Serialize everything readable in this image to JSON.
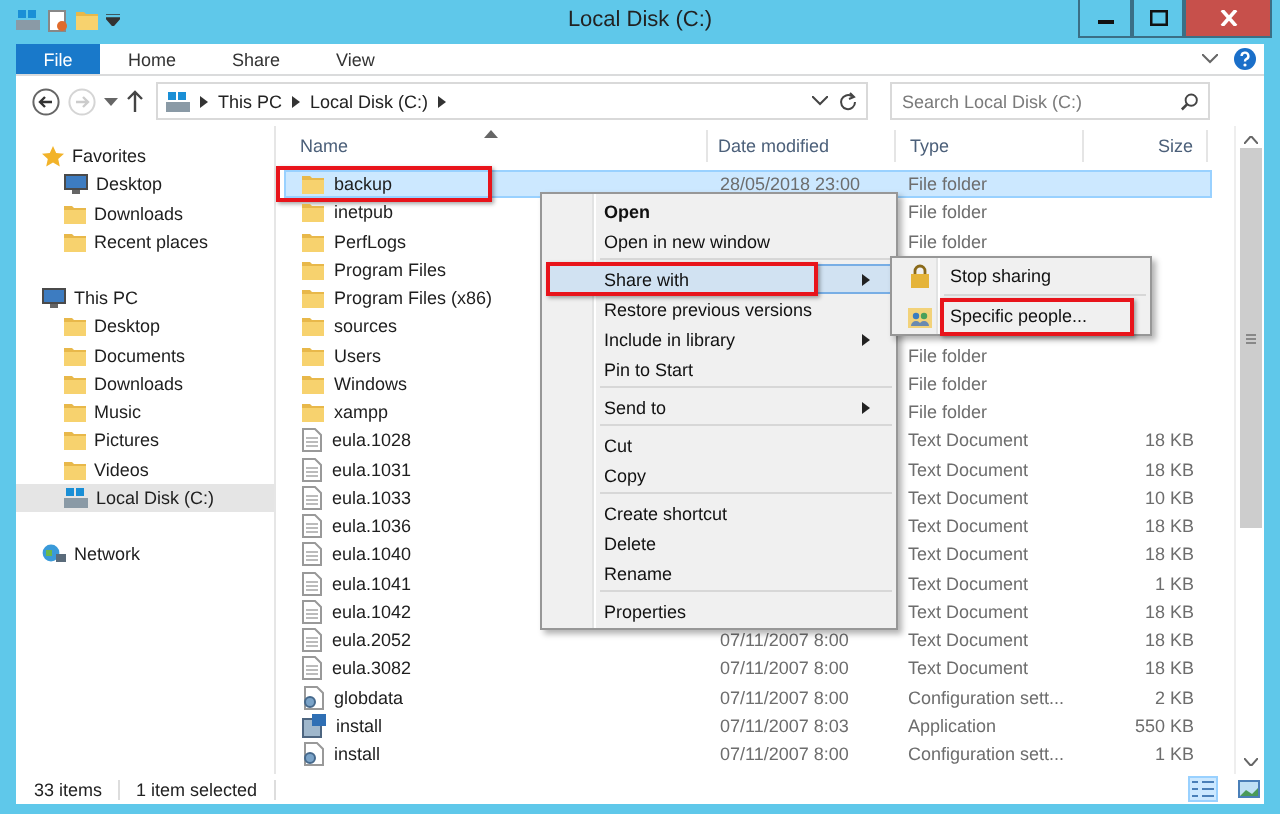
{
  "window": {
    "title": "Local Disk (C:)"
  },
  "ribbon_tabs": [
    {
      "label": "File",
      "kind": "file"
    },
    {
      "label": "Home",
      "kind": "tab"
    },
    {
      "label": "Share",
      "kind": "tab"
    },
    {
      "label": "View",
      "kind": "tab"
    }
  ],
  "address": {
    "path": [
      "This PC",
      "Local Disk (C:)"
    ]
  },
  "search": {
    "placeholder": "Search Local Disk (C:)"
  },
  "sidebar": {
    "groups": [
      {
        "label": "Favorites",
        "children": [
          {
            "label": "Desktop",
            "selected": false
          },
          {
            "label": "Downloads",
            "selected": false
          },
          {
            "label": "Recent places",
            "selected": false
          }
        ]
      },
      {
        "label": "This PC",
        "children": [
          {
            "label": "Desktop",
            "selected": false
          },
          {
            "label": "Documents",
            "selected": false
          },
          {
            "label": "Downloads",
            "selected": false
          },
          {
            "label": "Music",
            "selected": false
          },
          {
            "label": "Pictures",
            "selected": false
          },
          {
            "label": "Videos",
            "selected": false
          },
          {
            "label": "Local Disk (C:)",
            "selected": true
          }
        ]
      },
      {
        "label": "Network"
      }
    ]
  },
  "columns": [
    "Name",
    "Date modified",
    "Type",
    "Size"
  ],
  "rows": [
    {
      "name": "backup",
      "date": "28/05/2018 23:00",
      "type": "File folder",
      "kind": "folder",
      "selected": true,
      "annotated": true
    },
    {
      "name": "inetpub",
      "type": "File folder",
      "kind": "folder",
      "selected": false,
      "annotated": false
    },
    {
      "name": "PerfLogs",
      "type": "File folder",
      "kind": "folder",
      "selected": false,
      "annotated": false
    },
    {
      "name": "Program Files",
      "kind": "folder",
      "selected": false,
      "annotated": false
    },
    {
      "name": "Program Files (x86)",
      "kind": "folder",
      "selected": false,
      "annotated": false
    },
    {
      "name": "sources",
      "kind": "folder",
      "selected": false,
      "annotated": false
    },
    {
      "name": "Users",
      "type": "File folder",
      "kind": "folder",
      "selected": false,
      "annotated": false
    },
    {
      "name": "Windows",
      "type": "File folder",
      "kind": "folder",
      "selected": false,
      "annotated": false
    },
    {
      "name": "xampp",
      "type": "File folder",
      "kind": "folder",
      "selected": false,
      "annotated": false
    },
    {
      "name": "eula.1028",
      "type": "Text Document",
      "size": "18 KB",
      "kind": "text",
      "selected": false,
      "annotated": false
    },
    {
      "name": "eula.1031",
      "type": "Text Document",
      "size": "18 KB",
      "kind": "text",
      "selected": false,
      "annotated": false
    },
    {
      "name": "eula.1033",
      "type": "Text Document",
      "size": "10 KB",
      "kind": "text",
      "selected": false,
      "annotated": false
    },
    {
      "name": "eula.1036",
      "type": "Text Document",
      "size": "18 KB",
      "kind": "text",
      "selected": false,
      "annotated": false
    },
    {
      "name": "eula.1040",
      "type": "Text Document",
      "size": "18 KB",
      "kind": "text",
      "selected": false,
      "annotated": false
    },
    {
      "name": "eula.1041",
      "type": "Text Document",
      "size": "1 KB",
      "kind": "text",
      "selected": false,
      "annotated": false
    },
    {
      "name": "eula.1042",
      "type": "Text Document",
      "size": "18 KB",
      "kind": "text",
      "selected": false,
      "annotated": false
    },
    {
      "name": "eula.2052",
      "date": "07/11/2007 8:00",
      "type": "Text Document",
      "size": "18 KB",
      "kind": "text",
      "selected": false,
      "annotated": false
    },
    {
      "name": "eula.3082",
      "date": "07/11/2007 8:00",
      "type": "Text Document",
      "size": "18 KB",
      "kind": "text",
      "selected": false,
      "annotated": false
    },
    {
      "name": "globdata",
      "date": "07/11/2007 8:00",
      "type": "Configuration sett...",
      "size": "2 KB",
      "kind": "config",
      "selected": false,
      "annotated": false
    },
    {
      "name": "install",
      "date": "07/11/2007 8:03",
      "type": "Application",
      "size": "550 KB",
      "kind": "app",
      "selected": false,
      "annotated": false
    },
    {
      "name": "install",
      "date": "07/11/2007 8:00",
      "type": "Configuration sett...",
      "size": "1 KB",
      "kind": "config",
      "selected": false,
      "annotated": false
    }
  ],
  "context_menu": {
    "items": [
      {
        "kind": "item",
        "label": "Open",
        "default": true,
        "has_submenu": false,
        "highlighted": false,
        "annotated": false
      },
      {
        "kind": "item",
        "label": "Open in new window",
        "default": false,
        "has_submenu": false,
        "highlighted": false,
        "annotated": false
      },
      {
        "kind": "separator"
      },
      {
        "kind": "item",
        "label": "Share with",
        "default": false,
        "has_submenu": true,
        "highlighted": true,
        "annotated": true
      },
      {
        "kind": "item",
        "label": "Restore previous versions",
        "default": false,
        "has_submenu": false,
        "highlighted": false,
        "annotated": false
      },
      {
        "kind": "item",
        "label": "Include in library",
        "default": false,
        "has_submenu": true,
        "highlighted": false,
        "annotated": false
      },
      {
        "kind": "item",
        "label": "Pin to Start",
        "default": false,
        "has_submenu": false,
        "highlighted": false,
        "annotated": false
      },
      {
        "kind": "separator"
      },
      {
        "kind": "item",
        "label": "Send to",
        "default": false,
        "has_submenu": true,
        "highlighted": false,
        "annotated": false
      },
      {
        "kind": "separator"
      },
      {
        "kind": "item",
        "label": "Cut",
        "default": false,
        "has_submenu": false,
        "highlighted": false,
        "annotated": false
      },
      {
        "kind": "item",
        "label": "Copy",
        "default": false,
        "has_submenu": false,
        "highlighted": false,
        "annotated": false
      },
      {
        "kind": "separator"
      },
      {
        "kind": "item",
        "label": "Create shortcut",
        "default": false,
        "has_submenu": false,
        "highlighted": false,
        "annotated": false
      },
      {
        "kind": "item",
        "label": "Delete",
        "default": false,
        "has_submenu": false,
        "highlighted": false,
        "annotated": false
      },
      {
        "kind": "item",
        "label": "Rename",
        "default": false,
        "has_submenu": false,
        "highlighted": false,
        "annotated": false
      },
      {
        "kind": "separator"
      },
      {
        "kind": "item",
        "label": "Properties",
        "default": false,
        "has_submenu": false,
        "highlighted": false,
        "annotated": false
      }
    ]
  },
  "submenu": {
    "items": [
      {
        "kind": "item",
        "label": "Stop sharing",
        "annotated": false
      },
      {
        "kind": "separator"
      },
      {
        "kind": "item",
        "label": "Specific people...",
        "annotated": true
      }
    ]
  },
  "status_bar": {
    "item_count": "33 items",
    "selection": "1 item selected"
  },
  "view_buttons": [
    {
      "selected": true
    },
    {
      "selected": false
    }
  ]
}
